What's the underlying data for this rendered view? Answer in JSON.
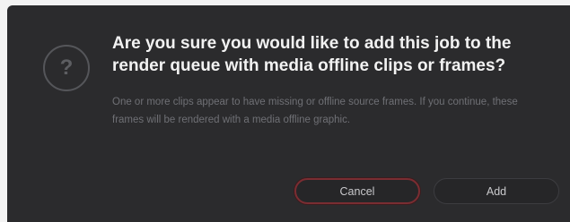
{
  "dialog": {
    "icon": "question-mark-icon",
    "icon_glyph": "?",
    "title": "Are you sure you would like to add this job to the render queue with media offline clips or frames?",
    "message": "One or more clips appear to have missing or offline source frames. If you continue, these frames will be rendered with a media offline graphic.",
    "buttons": {
      "cancel_label": "Cancel",
      "add_label": "Add"
    }
  },
  "colors": {
    "background": "#2b2b2d",
    "title_text": "#f2f2f2",
    "message_text": "#6f7075",
    "focus_ring": "#7a2d32"
  }
}
